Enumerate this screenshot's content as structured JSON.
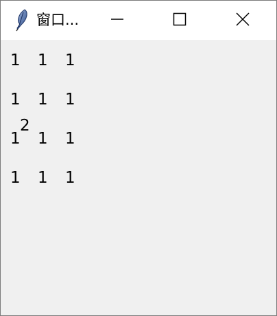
{
  "window": {
    "title": "窗口...",
    "icon": "feather-icon",
    "buttons": {
      "minimize": "minimize-icon",
      "maximize": "maximize-icon",
      "close": "close-icon"
    }
  },
  "grid": {
    "rows": [
      [
        "1",
        "1",
        "1"
      ],
      [
        "1",
        "1",
        "1"
      ],
      [
        "1",
        "1",
        "1"
      ],
      [
        "1",
        "1",
        "1"
      ]
    ],
    "overlay_label": "2"
  }
}
